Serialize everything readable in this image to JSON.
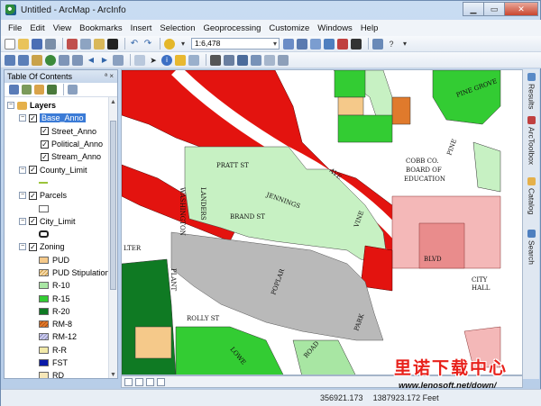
{
  "window": {
    "title": "Untitled - ArcMap - ArcInfo"
  },
  "menubar": {
    "items": [
      "File",
      "Edit",
      "View",
      "Bookmarks",
      "Insert",
      "Selection",
      "Geoprocessing",
      "Customize",
      "Windows",
      "Help"
    ]
  },
  "toolbar": {
    "scale": "1:6,478"
  },
  "toc": {
    "title": "Table Of Contents",
    "pin_glyphs": "ª ×",
    "root": "Layers",
    "groups": [
      {
        "label": "Base_Anno",
        "selected": true,
        "children": [
          "Street_Anno",
          "Political_Anno",
          "Stream_Anno"
        ]
      },
      {
        "label": "County_Limit"
      },
      {
        "label": "Parcels"
      },
      {
        "label": "City_Limit"
      },
      {
        "label": "Zoning"
      }
    ],
    "zoning_legend": [
      {
        "label": "PUD",
        "color": "#f5c98a"
      },
      {
        "label": "PUD Stipulation",
        "color": "#f6d9a8"
      },
      {
        "label": "R-10",
        "color": "#a8e6a3"
      },
      {
        "label": "R-15",
        "color": "#33cc33"
      },
      {
        "label": "R-20",
        "color": "#0f7a23"
      },
      {
        "label": "RM-8",
        "color": "#e07a2c"
      },
      {
        "label": "RM-12",
        "color": "#ccccee"
      },
      {
        "label": "R-R",
        "color": "#f2e9a8"
      },
      {
        "label": "FST",
        "color": "#0a1aa8"
      },
      {
        "label": "RD",
        "color": "#f6e7b8"
      }
    ]
  },
  "map": {
    "labels": {
      "pratt": "PRATT ST",
      "cobb1": "COBB CO.",
      "cobb2": "BOARD OF",
      "cobb3": "EDUCATION",
      "washington": "WASHINGTON",
      "landers": "LANDERS",
      "jennings": "JENNINGS",
      "brand": "BRAND ST",
      "vine": "VINE",
      "pine": "PINE",
      "rolly": "ROLLY ST",
      "poplar": "POPLAR",
      "park": "PARK",
      "city": "CITY",
      "hall": "HALL",
      "lter": "LTER",
      "blvd": "BLVD",
      "pine_grove": "PINE GROVE",
      "lowe": "LOWE",
      "road": "ROAD",
      "ave": "AVE",
      "plant": "PLANT"
    }
  },
  "dock": {
    "tabs": [
      "Results",
      "ArcToolbox",
      "Catalog",
      "Search"
    ]
  },
  "status": {
    "x": "356921.173",
    "y": "1387923.172 Feet"
  },
  "watermark": {
    "cn": "里诺下载中心",
    "url": "www.lenosoft.net/down/"
  }
}
